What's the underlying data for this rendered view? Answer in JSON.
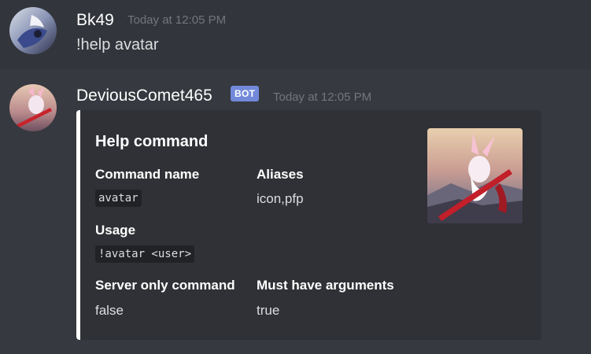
{
  "messages": [
    {
      "author": "Bk49",
      "timestamp": "Today at 12:05 PM",
      "content": "!help avatar"
    },
    {
      "author": "DeviousComet465",
      "badge": "BOT",
      "timestamp": "Today at 12:05 PM",
      "embed": {
        "title": "Help command",
        "accent_color": "#ffffff",
        "thumbnail_icon": "anime-character-thumbnail",
        "fields": [
          {
            "name": "Command name",
            "value": "avatar",
            "is_code": true
          },
          {
            "name": "Aliases",
            "value": "icon,pfp",
            "is_code": false
          },
          {
            "name": "Usage",
            "value": "!avatar <user>",
            "is_code": true
          },
          {
            "name": "Server only command",
            "value": "false",
            "is_code": false
          },
          {
            "name": "Must have arguments",
            "value": "true",
            "is_code": false
          }
        ]
      }
    }
  ],
  "colors": {
    "background": "#36393f",
    "hover_background": "#32353b",
    "embed_background": "#2f3136",
    "bot_badge": "#7289da",
    "timestamp": "#72767d",
    "text": "#dcddde"
  }
}
